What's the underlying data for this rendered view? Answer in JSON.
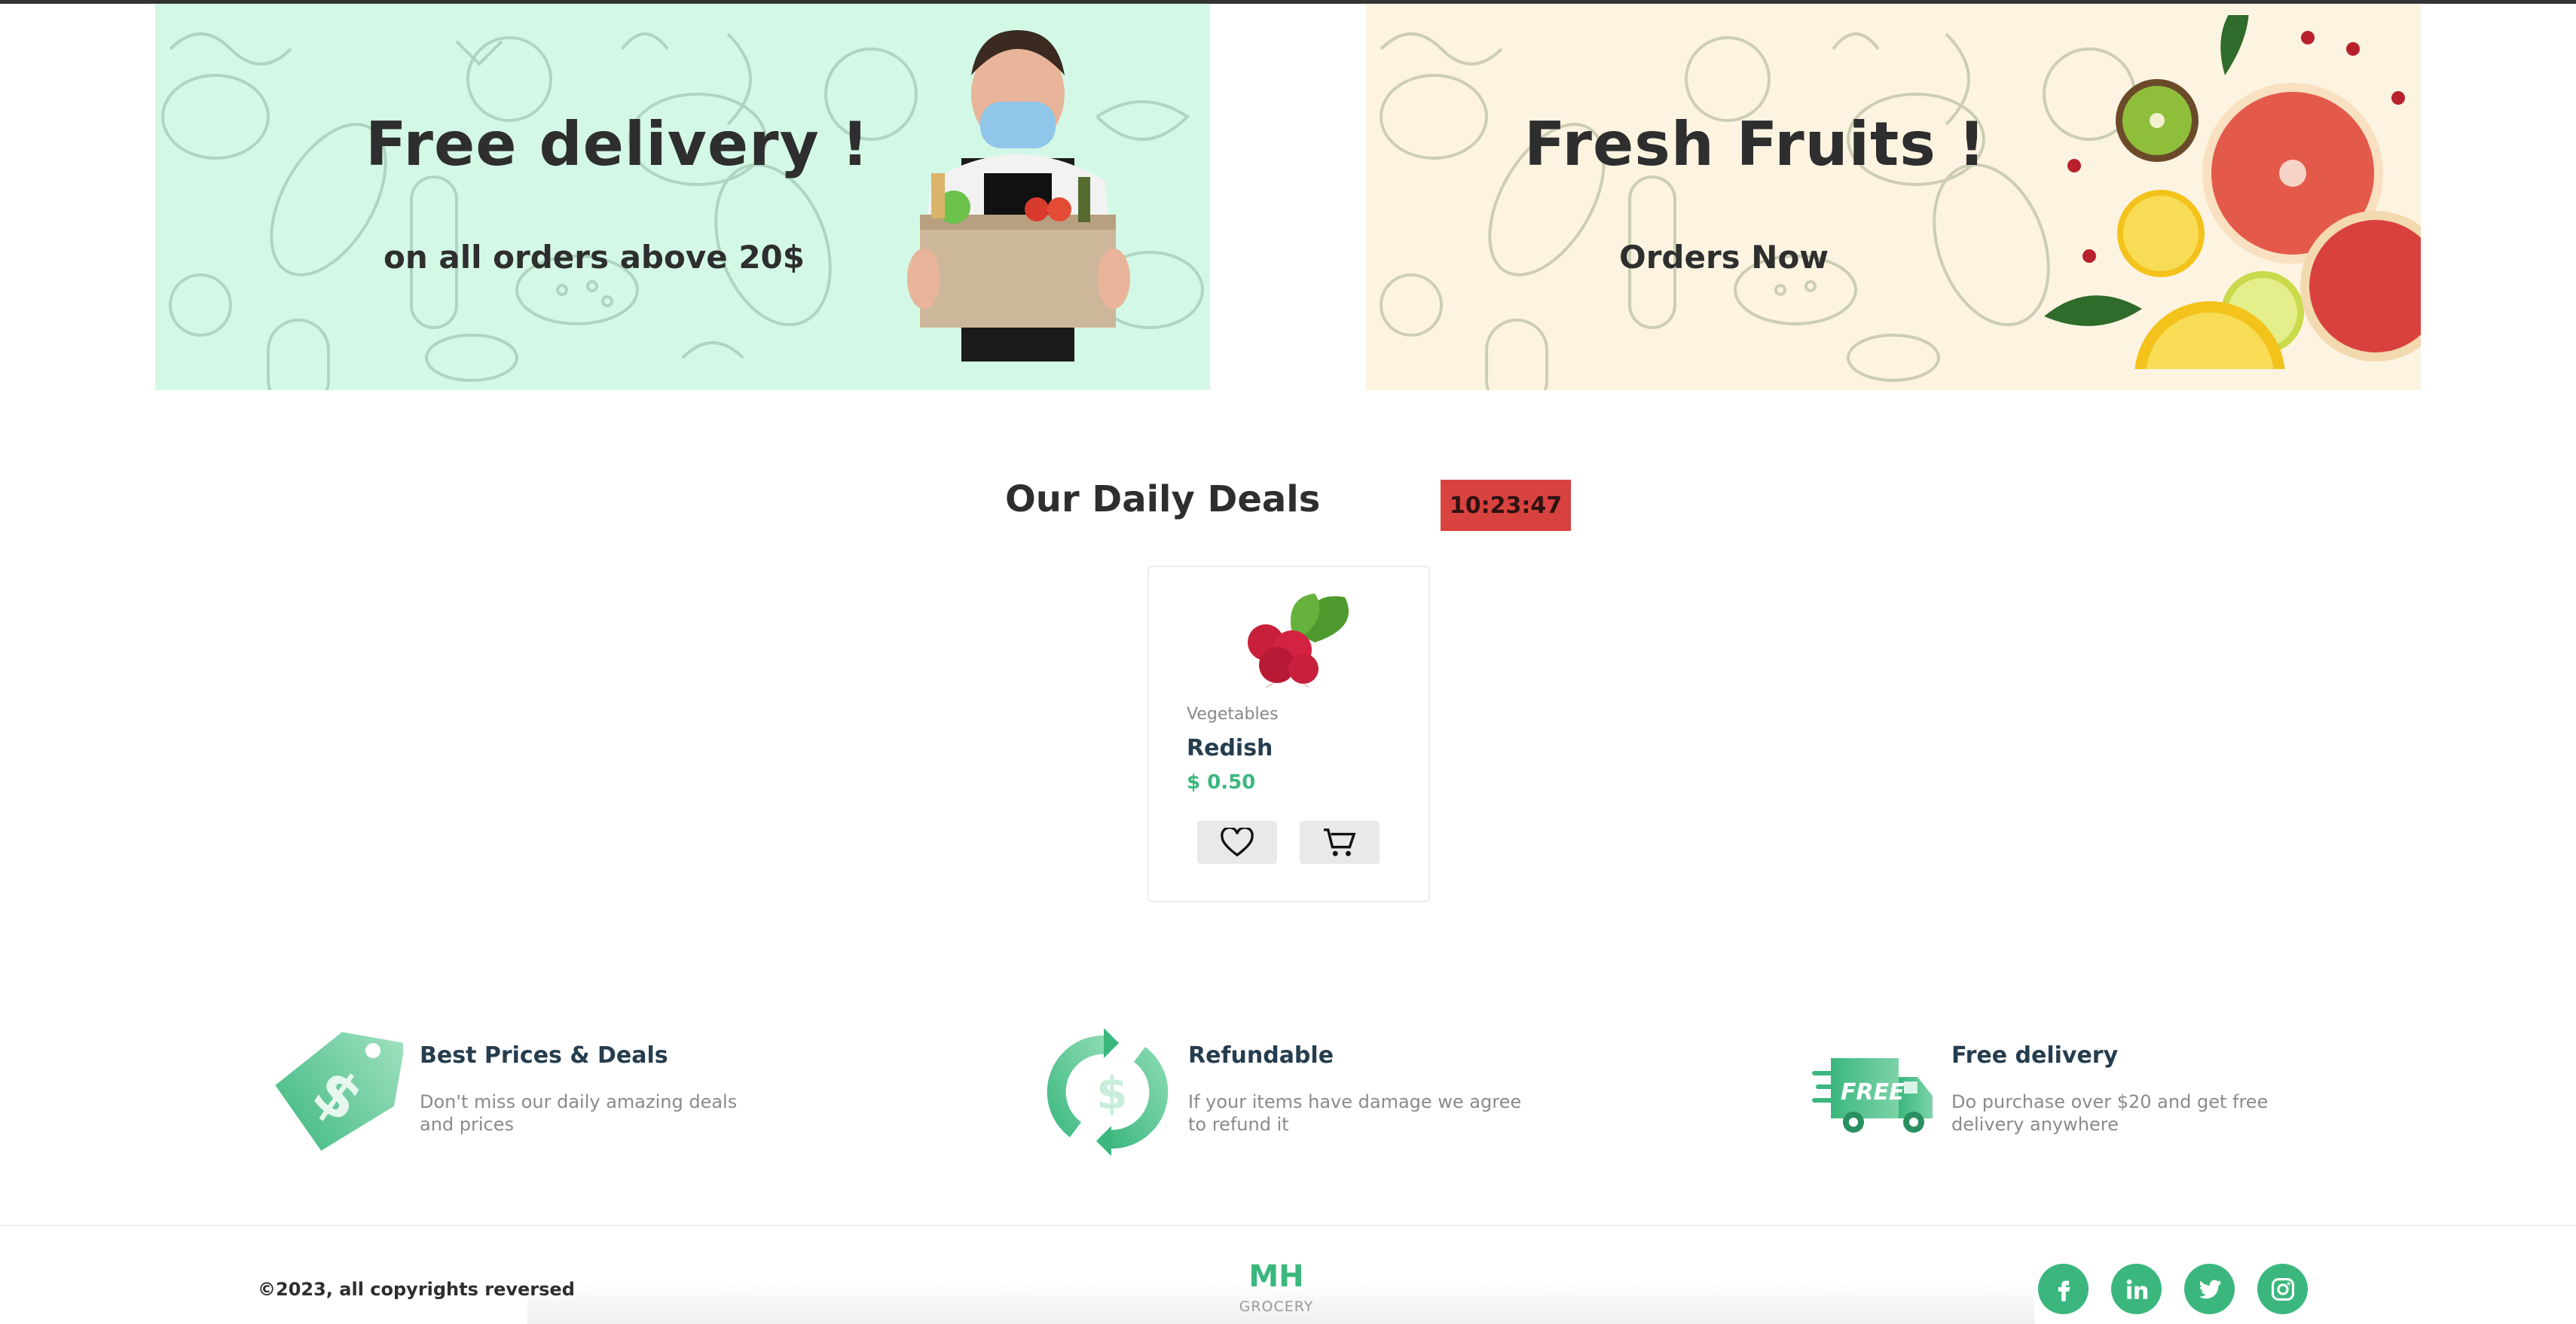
{
  "banners": [
    {
      "title": "Free delivery !",
      "subtitle": "on all orders above 20$",
      "bg": "#d3f8e6"
    },
    {
      "title": "Fresh Fruits !",
      "subtitle": "Orders Now",
      "bg": "#fdf3e1"
    }
  ],
  "deals": {
    "title": "Our Daily Deals",
    "timer": "10:23:47",
    "timer_color": "#d9433f",
    "product": {
      "category": "Vegetables",
      "name": "Redish",
      "price": "$ 0.50",
      "wishlist_icon": "heart-icon",
      "cart_icon": "cart-icon"
    }
  },
  "features": [
    {
      "title": "Best Prices & Deals",
      "description": "Don't miss our daily amazing deals and prices",
      "icon": "price-tag-icon"
    },
    {
      "title": "Refundable",
      "description": "If your items have damage we agree to refund it",
      "icon": "refund-icon"
    },
    {
      "title": "Free delivery",
      "description": "Do purchase over $20 and get free delivery anywhere",
      "icon": "delivery-truck-icon",
      "badge": "FREE"
    }
  ],
  "footer": {
    "copyright": "©2023, all copyrights reversed",
    "logo": "MH",
    "logo_sub": "GROCERY",
    "social": [
      "facebook-icon",
      "linkedin-icon",
      "twitter-icon",
      "instagram-icon"
    ]
  },
  "colors": {
    "accent": "#3bb77e",
    "heading": "#2e2e2e",
    "muted": "#8a8a8a"
  }
}
